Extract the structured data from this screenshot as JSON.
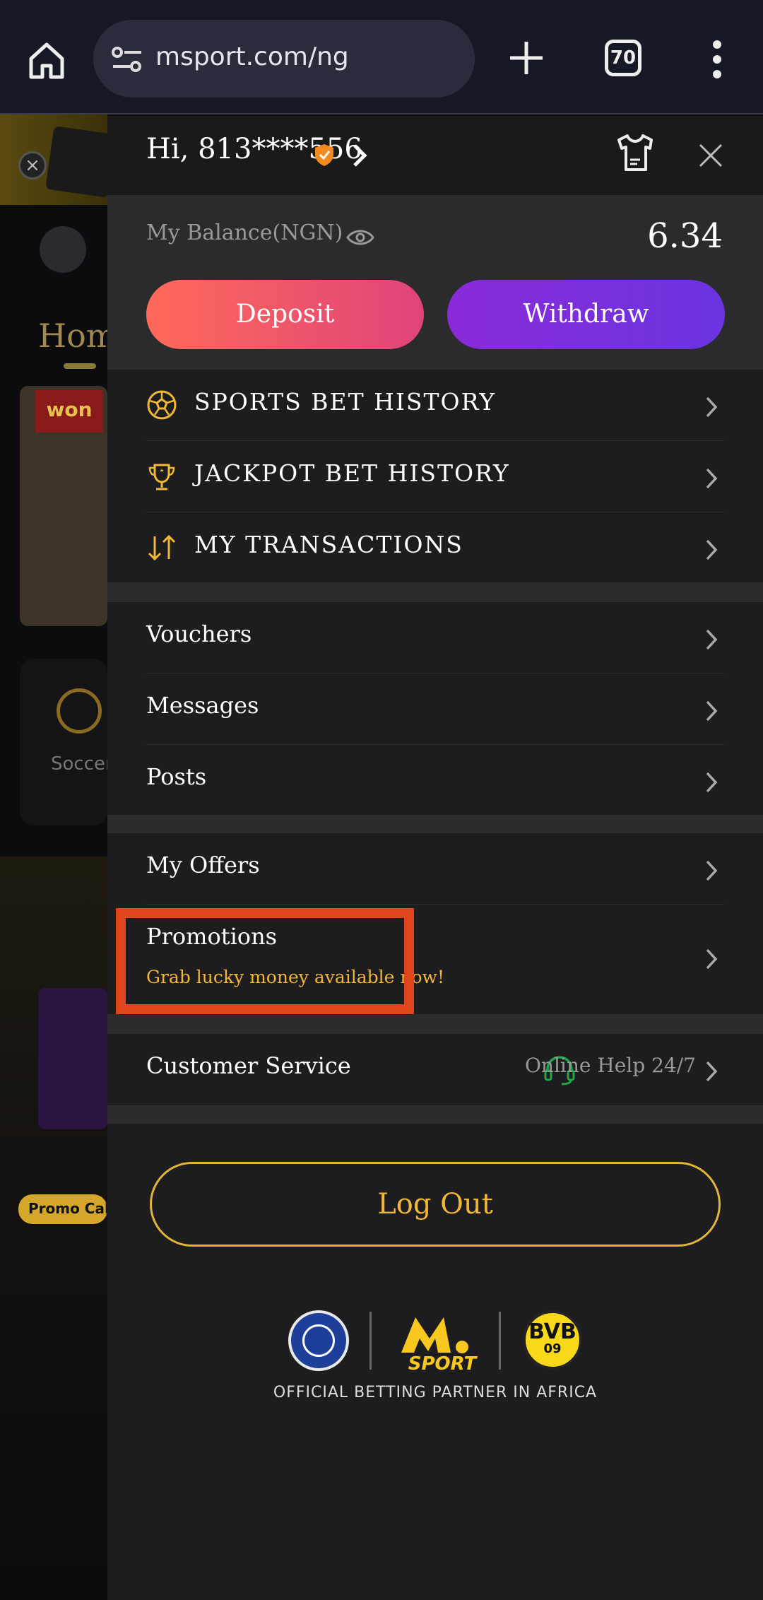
{
  "browser": {
    "url": "msport.com/ng",
    "tab_count": "70"
  },
  "background": {
    "home_label": "Hom",
    "banner_badge": "won",
    "soccer_label": "Soccer",
    "promo_label": "Promo Cal"
  },
  "drawer": {
    "greeting": "Hi, 813****556",
    "balance_label": "My Balance(NGN)",
    "balance_value": "6.34",
    "deposit_label": "Deposit",
    "withdraw_label": "Withdraw",
    "history_items": [
      {
        "label": "SPORTS BET HISTORY",
        "icon": "soccer-ball-icon"
      },
      {
        "label": "JACKPOT BET HISTORY",
        "icon": "trophy-icon"
      },
      {
        "label": "MY TRANSACTIONS",
        "icon": "transfer-arrows-icon"
      }
    ],
    "account_items": [
      "Vouchers",
      "Messages",
      "Posts"
    ],
    "offers": {
      "my_offers": "My Offers",
      "promotions": "Promotions",
      "promotions_sub": "Grab lucky money available now!"
    },
    "customer_service": {
      "label": "Customer Service",
      "help": "Online Help 24/7"
    },
    "logout_label": "Log Out",
    "partners_caption": "OFFICIAL BETTING PARTNER IN AFRICA",
    "partner_logo_text": {
      "bvb": "BVB",
      "bvb_year": "09",
      "msport": "SPORT"
    }
  },
  "colors": {
    "accent_gold": "#f0b836",
    "deposit": "#ff6a5a",
    "withdraw": "#7a30dc",
    "highlight": "#e0441a",
    "headset_green": "#1fa84a"
  }
}
